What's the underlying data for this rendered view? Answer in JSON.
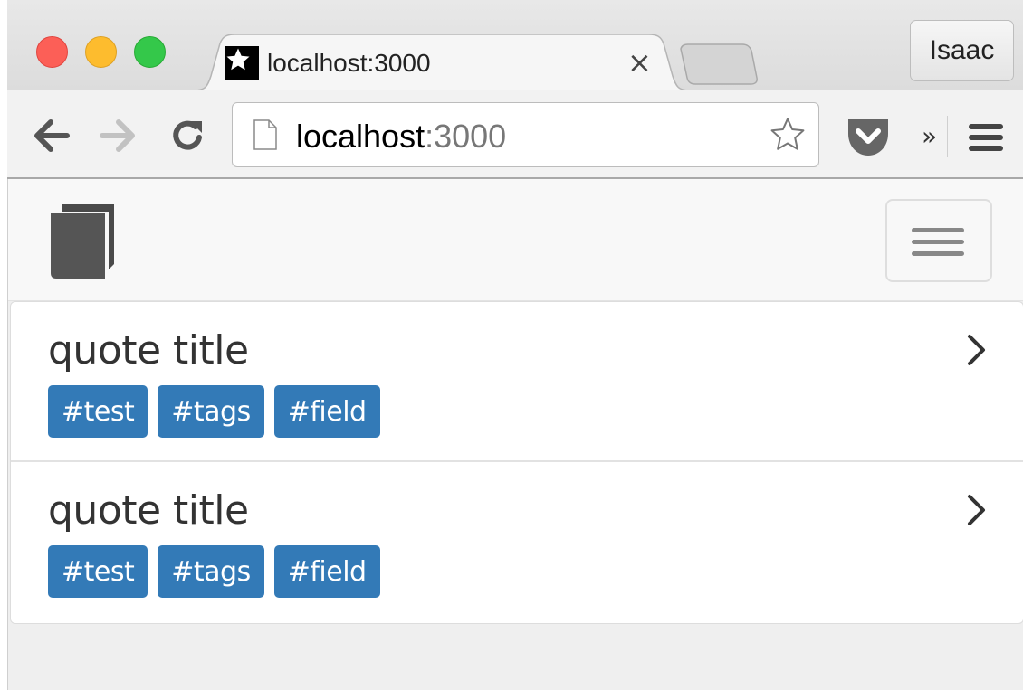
{
  "browser": {
    "tab_title": "localhost:3000",
    "close_glyph": "×",
    "profile_name": "Isaac",
    "address_host": "localhost",
    "address_port": ":3000",
    "overflow_glyph": "»",
    "icons": [
      "back-arrow-icon",
      "forward-arrow-icon",
      "reload-icon",
      "page-icon",
      "bookmark-star-icon",
      "pocket-icon",
      "menu-icon",
      "favicon-star-icon"
    ]
  },
  "app": {
    "brand_icon": "book-icon",
    "nav_toggle_icon": "hamburger-icon"
  },
  "quotes": [
    {
      "title": "quote title",
      "tags": [
        "#test",
        "#tags",
        "#field"
      ]
    },
    {
      "title": "quote title",
      "tags": [
        "#test",
        "#tags",
        "#field"
      ]
    }
  ],
  "colors": {
    "tag_bg": "#337ab7",
    "close_red": "#fc5f57",
    "minimize_yellow": "#fdbc2e",
    "zoom_green": "#34c84a"
  }
}
